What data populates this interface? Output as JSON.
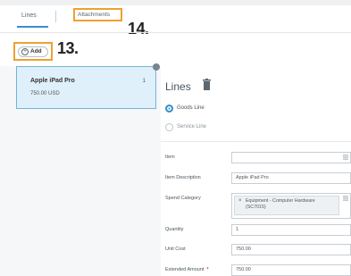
{
  "tabs": [
    {
      "label": "Lines",
      "active": true
    },
    {
      "label": "Attachments",
      "active": false
    }
  ],
  "callouts": {
    "attachments": "14.",
    "add": "13."
  },
  "toolbar": {
    "add_label": "Add"
  },
  "lines_list": [
    {
      "title": "Apple iPad Pro",
      "count": "1",
      "price": "750.00 USD",
      "selected": true
    }
  ],
  "detail": {
    "heading": "Lines",
    "line_types": [
      {
        "label": "Goods Line",
        "selected": true
      },
      {
        "label": "Service Line",
        "selected": false
      }
    ],
    "fields": {
      "item": {
        "label": "Item",
        "value": ""
      },
      "description": {
        "label": "Item Description",
        "value": "Apple iPad Pro"
      },
      "spend_category": {
        "label": "Spend Category",
        "value": "Equipment - Computer Hardware (SC7015)"
      },
      "quantity": {
        "label": "Quantity",
        "value": "1"
      },
      "unit_cost": {
        "label": "Unit Cost",
        "value": "750.00"
      },
      "extended_amount": {
        "label": "Extended Amount",
        "value": "750.00",
        "required_mark": "*"
      }
    }
  },
  "colors": {
    "accent": "#3a8ec9",
    "highlight": "#f0a030",
    "selected_bg": "#dff0fb",
    "required": "#d23b3b"
  }
}
